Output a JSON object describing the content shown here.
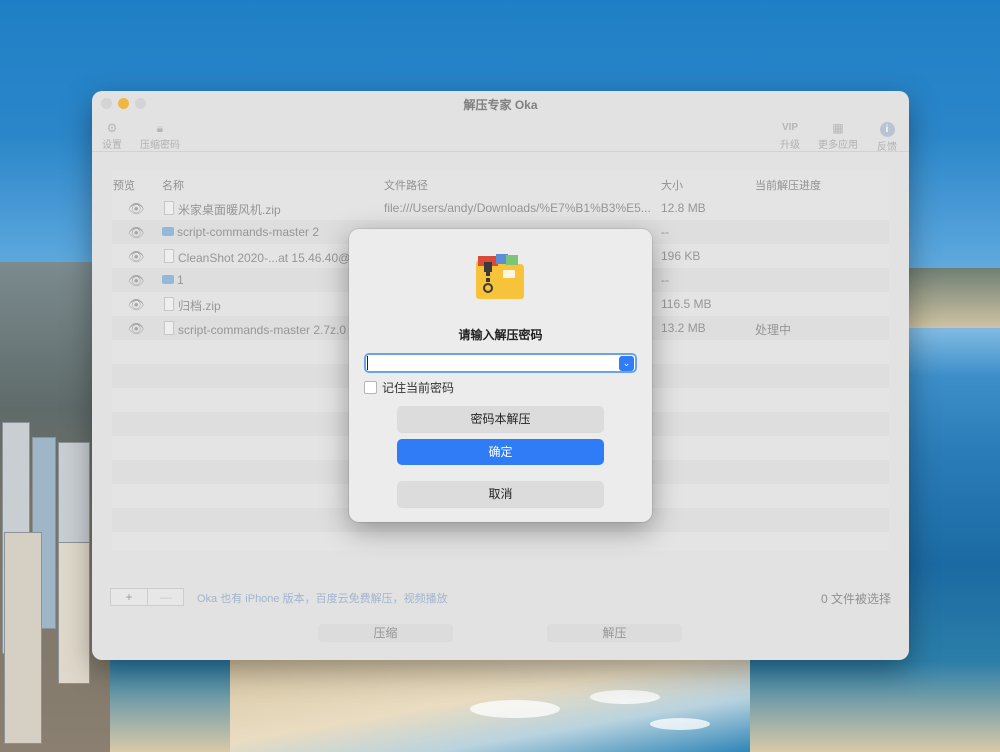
{
  "window": {
    "title": "解压专家 Oka"
  },
  "toolbar": {
    "settings": {
      "label": "设置",
      "icon": "gear-icon"
    },
    "compress_password": {
      "label": "压缩密码",
      "icon": "lock-icon"
    },
    "vip": {
      "badge": "VIP",
      "label": "升级"
    },
    "more_apps": {
      "label": "更多应用",
      "icon": "grid-icon"
    },
    "feedback": {
      "label": "反馈",
      "icon": "info-icon"
    }
  },
  "table": {
    "headers": [
      "预览",
      "名称",
      "文件路径",
      "大小",
      "当前解压进度"
    ],
    "rows": [
      {
        "name": "米家桌面暖风机.zip",
        "type": "file",
        "path": "file:///Users/andy/Downloads/%E7%B1%B3%E5...",
        "size": "12.8 MB",
        "progress": ""
      },
      {
        "name": "script-commands-master 2",
        "type": "folder",
        "path": "",
        "size": "--",
        "progress": ""
      },
      {
        "name": "CleanShot 2020-...at 15.46.40@",
        "type": "file",
        "path": "",
        "size": "196 KB",
        "progress": ""
      },
      {
        "name": "1",
        "type": "folder",
        "path": "",
        "size": "--",
        "progress": ""
      },
      {
        "name": "归档.zip",
        "type": "file",
        "path": "",
        "size": "116.5 MB",
        "progress": ""
      },
      {
        "name": "script-commands-master 2.7z.0",
        "type": "file",
        "path": "",
        "size": "13.2 MB",
        "progress": "处理中"
      }
    ]
  },
  "footer": {
    "add": "+",
    "remove": "—",
    "promo": "Oka 也有 iPhone 版本，百度云免费解压，视频播放",
    "selected_count": "0 文件被选择",
    "compress": "压缩",
    "extract": "解压"
  },
  "dialog": {
    "title": "请输入解压密码",
    "password_value": "",
    "remember_label": "记住当前密码",
    "remember_checked": false,
    "keychain_button": "密码本解压",
    "ok_button": "确定",
    "cancel_button": "取消"
  },
  "colors": {
    "accent": "#2f7cf6",
    "promo_link": "#9db3cf"
  }
}
